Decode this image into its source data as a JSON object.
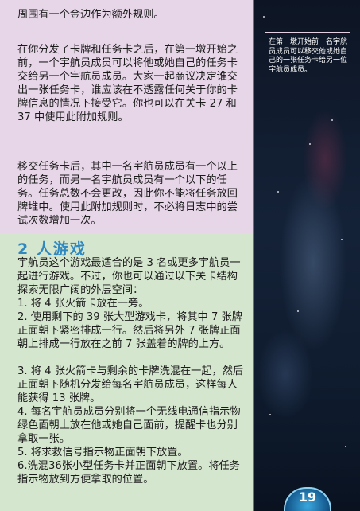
{
  "main": {
    "intro_rule": "周围有一个金边作为额外规则。",
    "paragraph_1": "在你分发了卡牌和任务卡之后，在第一墩开始之前，一个宇航员成员可以将他或她自己的任务卡交给另一个宇航员成员。大家一起商议决定谁交出一张任务卡，谁应该在不透露任何关于你的卡牌信息的情况下接受它。你也可以在关卡 27 和 37 中使用此附加规则。",
    "paragraph_2": "移交任务卡后，其中一名宇航员成员有一个以上的任务，而另一名宇航员成员有一个以下的任务。任务总数不会更改，因此你不能将任务放回牌堆中。使用此附加规则时，不必将日志中的尝试次数增加一次。"
  },
  "section": {
    "heading": "2 人游戏",
    "intro": "宇航员这个游戏最适合的是 3 名或更多宇航员一起进行游戏。不过，你也可以通过以下关卡结构探索无限广阔的外层空间：",
    "steps": [
      "1. 将 4 张火箭卡放在一旁。",
      "2. 使用剩下的 39 张大型游戏卡，将其中 7 张牌正面朝下紧密排成一行。然后将另外 7 张牌正面朝上排成一行放在之前 7 张盖着的牌的上方。",
      "3. 将 4 张火箭卡与剩余的卡牌洗混在一起，然后正面朝下随机分发给每名宇航员成员，这样每人能获得 13 张牌。",
      "4. 每名宇航员成员分别将一个无线电通信指示物绿色面朝上放在他或她自己面前，提醒卡也分别拿取一张。",
      "5. 将求救信号指示物正面朝下放置。",
      "6.洗混36张小型任务卡并正面朝下放置。将任务指示物放到方便拿取的位置。"
    ]
  },
  "sidebar": {
    "note": "在第一墩开始前一名宇航员成员可以移交他或她自己的一张任务卡给另一位宇航员成员。"
  },
  "footer": {
    "page_number": "19"
  }
}
